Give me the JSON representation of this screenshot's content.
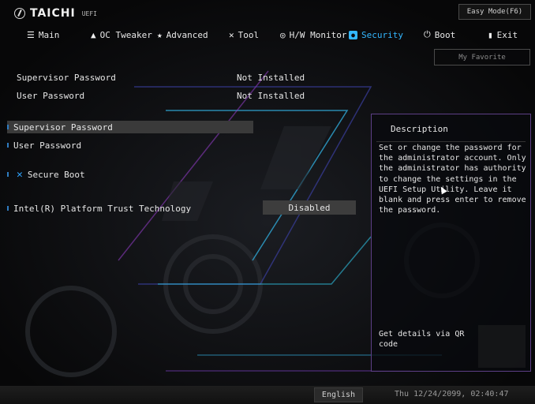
{
  "header": {
    "brand": "TAICHI",
    "uefi": "UEFI",
    "easy_mode": "Easy Mode(F6)",
    "my_favorite": "My Favorite"
  },
  "tabs": [
    {
      "label": "Main",
      "icon": "list-icon",
      "active": false
    },
    {
      "label": "OC Tweaker",
      "icon": "rocket-icon",
      "active": false
    },
    {
      "label": "Advanced",
      "icon": "star-icon",
      "active": false
    },
    {
      "label": "Tool",
      "icon": "wrench-icon",
      "active": false
    },
    {
      "label": "H/W Monitor",
      "icon": "monitor-icon",
      "active": false
    },
    {
      "label": "Security",
      "icon": "shield-icon",
      "active": true
    },
    {
      "label": "Boot",
      "icon": "power-icon",
      "active": false
    },
    {
      "label": "Exit",
      "icon": "door-icon",
      "active": false
    }
  ],
  "status": {
    "supervisor_label": "Supervisor Password",
    "supervisor_value": "Not Installed",
    "user_label": "User Password",
    "user_value": "Not Installed"
  },
  "menu": {
    "supervisor": "Supervisor Password",
    "user": "User Password",
    "secure_boot": "Secure Boot",
    "ptt": "Intel(R) Platform Trust Technology",
    "ptt_value": "Disabled"
  },
  "description": {
    "title": "Description",
    "body": "Set or change the password for\nthe administrator account. Only\nthe administrator has authority\nto change the settings in the\nUEFI Setup Utility. Leave it\nblank and press enter to remove\nthe password.",
    "qr_text": "Get details via QR code"
  },
  "footer": {
    "language": "English",
    "datetime": "Thu 12/24/2099, 02:40:47"
  },
  "colors": {
    "accent": "#33b7ff",
    "panel_border": "#5d3f86",
    "selected_row": "#3a3a3a"
  }
}
